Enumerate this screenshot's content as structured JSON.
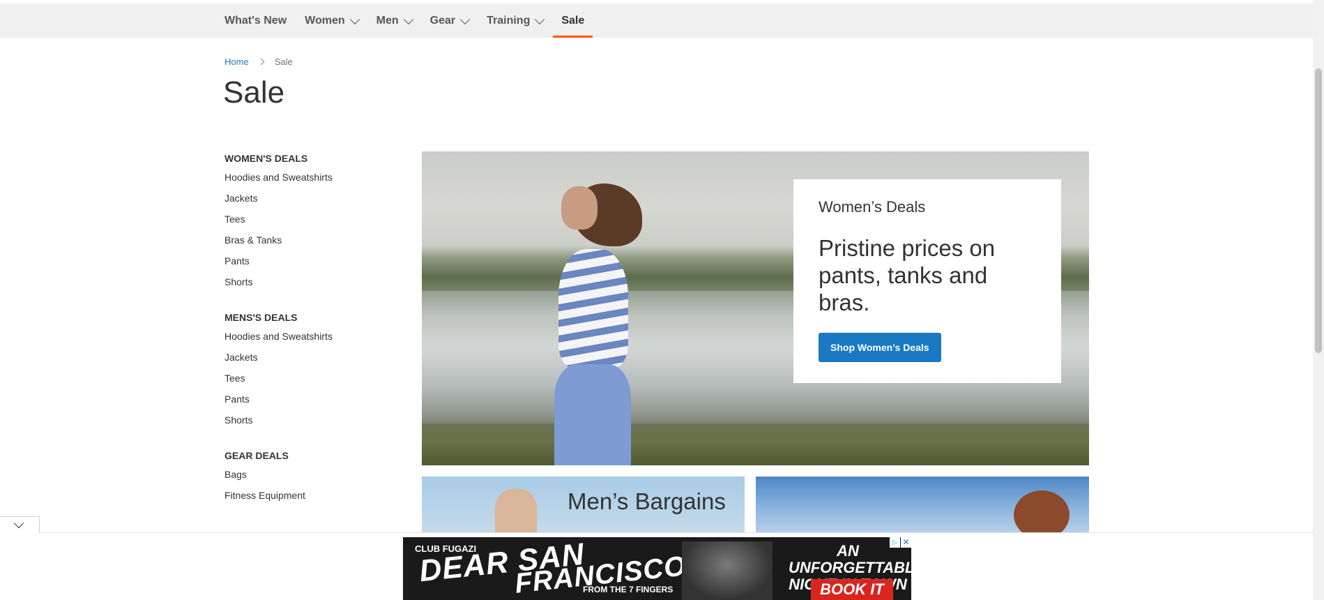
{
  "nav": {
    "items": [
      {
        "label": "What's New",
        "has_dropdown": false
      },
      {
        "label": "Women",
        "has_dropdown": true
      },
      {
        "label": "Men",
        "has_dropdown": true
      },
      {
        "label": "Gear",
        "has_dropdown": true
      },
      {
        "label": "Training",
        "has_dropdown": true
      },
      {
        "label": "Sale",
        "has_dropdown": false,
        "active": true
      }
    ],
    "active_color": "#ff5501"
  },
  "breadcrumb": {
    "home": "Home",
    "current": "Sale"
  },
  "page_title": "Sale",
  "sidebar": {
    "groups": [
      {
        "heading": "WOMEN'S DEALS",
        "links": [
          "Hoodies and Sweatshirts",
          "Jackets",
          "Tees",
          "Bras & Tanks",
          "Pants",
          "Shorts"
        ]
      },
      {
        "heading": "MENS'S DEALS",
        "links": [
          "Hoodies and Sweatshirts",
          "Jackets",
          "Tees",
          "Pants",
          "Shorts"
        ]
      },
      {
        "heading": "GEAR DEALS",
        "links": [
          "Bags",
          "Fitness Equipment"
        ]
      }
    ]
  },
  "hero": {
    "subtitle": "Women’s Deals",
    "headline": "Pristine prices on pants, tanks and bras.",
    "button_label": "Shop Women’s Deals",
    "button_color": "#1979c3"
  },
  "tiles": {
    "men_title": "Men’s Bargains"
  },
  "ad": {
    "brand": "CLUB FUGAZI",
    "line1": "DEAR SAN",
    "line2": "FRANCISCO",
    "from": "FROM THE 7 FINGERS",
    "tagline": "AN UNFORGETTABLE NIGHT IN TOWN",
    "cta": "BOOK IT",
    "close_glyph": "✕",
    "info_glyph": "▷"
  },
  "icons": {
    "dropdown": "chevron-down-icon",
    "breadcrumb_separator": "chevron-right-icon",
    "collapse": "chevron-down-icon"
  }
}
